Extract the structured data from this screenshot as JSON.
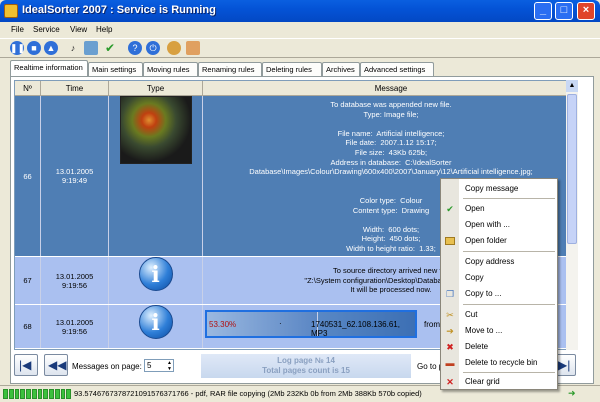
{
  "window": {
    "title": "IdealSorter 2007 : Service is Running"
  },
  "menu": [
    "File",
    "Service",
    "View",
    "Help"
  ],
  "tabs": [
    "Realtime information",
    "Main settings",
    "Moving rules",
    "Renaming rules",
    "Deleting rules",
    "Archives",
    "Advanced settings"
  ],
  "grid": {
    "headers": [
      "Nº",
      "Time",
      "Type",
      "Message"
    ],
    "rows": [
      {
        "n": "66",
        "date": "13.01.2005",
        "time": "9:19:49",
        "message": "To database was appended new file.\nType: Image file;\n\nFile name:  Artificial intelligence;\nFile date:  2007.1.12 15:17;\nFile size:  43Kb 625b;\nAddress in database:  C:\\IdealSorter\nDatabase\\Images\\Colour\\Drawing\\600x400\\2007\\January\\12\\Artificial intelligence.jpg;\n\n\nColor type:  Colour\nContent type:  Drawing\n\nWidth:  600 dots;\nHeight:  450 dots;\nWidth to height ratio:  1.33;"
      },
      {
        "n": "67",
        "date": "13.01.2005",
        "time": "9:19:56",
        "message": "To source directory arrived new file\n\"Z:\\System configuration\\Desktop\\Database\\New Fo\nIt will be processed now."
      },
      {
        "n": "68",
        "date": "13.01.2005",
        "time": "9:19:56",
        "progress_label": "53.30%",
        "progress": 0.533,
        "progress_text": "1740531_62.108.136.61, MP3",
        "from": "from"
      }
    ]
  },
  "bottom": {
    "messages_label": "Messages on page:",
    "messages_value": "5",
    "log_page": "Log page № 14",
    "total_pages": "Total pages count is 15",
    "goto": "Go to p"
  },
  "status": {
    "text": "93.5746767378721091576371766 - pdf, RAR file copying (2Mb 232Kb 0b  from   2Mb 388Kb 570b copied)"
  },
  "context_menu": [
    {
      "label": "Copy message",
      "icon": ""
    },
    {
      "label": "Open",
      "icon": "check"
    },
    {
      "label": "Open with ...",
      "icon": ""
    },
    {
      "label": "Open folder",
      "icon": "folder"
    },
    {
      "label": "Copy address",
      "icon": ""
    },
    {
      "label": "Copy",
      "icon": ""
    },
    {
      "label": "Copy to ...",
      "icon": "copy"
    },
    {
      "label": "Cut",
      "icon": "scissors"
    },
    {
      "label": "Move to ...",
      "icon": "move"
    },
    {
      "label": "Delete",
      "icon": "delete"
    },
    {
      "label": "Delete to recycle bin",
      "icon": "recycle"
    },
    {
      "label": "Clear grid",
      "icon": "clear"
    }
  ]
}
